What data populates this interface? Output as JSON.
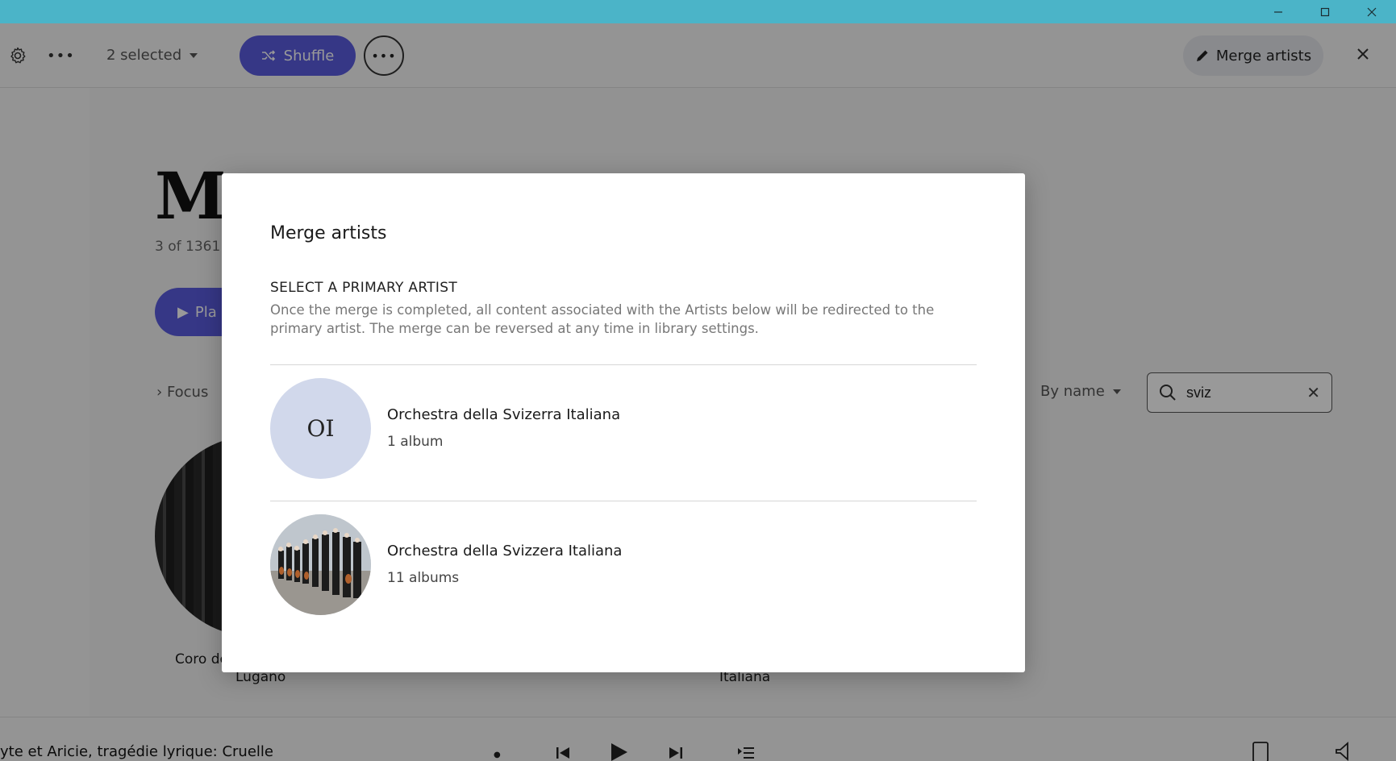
{
  "toolbar": {
    "selected_label": "2 selected",
    "shuffle_label": "Shuffle",
    "merge_label": "Merge artists"
  },
  "page": {
    "title": "My",
    "count": "3 of 1361",
    "play_label": "Pla",
    "focus_label": "Focus",
    "sort_label": "By name",
    "search_value": "sviz",
    "cards": [
      {
        "label": "Coro de"
      },
      {
        "label": "Lugano"
      },
      {
        "label": "Italiana"
      }
    ]
  },
  "player": {
    "track": "yte et Aricie, tragédie lyrique: Cruelle"
  },
  "modal": {
    "title": "Merge artists",
    "subheading": "SELECT A PRIMARY ARTIST",
    "description": "Once the merge is completed, all content associated with the Artists below will be redirected to the primary artist. The merge can be reversed at any time in library settings.",
    "artists": [
      {
        "initials": "OI",
        "name": "Orchestra della Svizerra Italiana",
        "count": "1 album"
      },
      {
        "name": "Orchestra della Svizzera Italiana",
        "count": "11 albums"
      }
    ]
  },
  "colors": {
    "accent": "#5a5ce0",
    "titlebar": "#4bb4c8",
    "avatar_initials_bg": "#d1d8eb"
  }
}
